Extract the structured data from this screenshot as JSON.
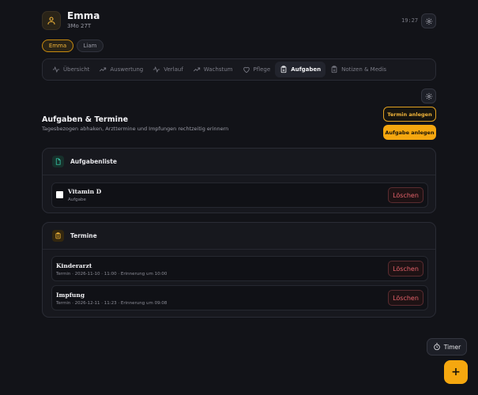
{
  "profile": {
    "name": "Emma",
    "age": "3Mo 27T",
    "clock": "19:27",
    "icon": "user-icon"
  },
  "children": [
    {
      "label": "Emma",
      "selected": true
    },
    {
      "label": "Liam",
      "selected": false
    }
  ],
  "tabs": [
    {
      "label": "Übersicht",
      "icon": "pulse-icon"
    },
    {
      "label": "Auswertung",
      "icon": "trend-icon"
    },
    {
      "label": "Verlauf",
      "icon": "pulse-icon"
    },
    {
      "label": "Wachstum",
      "icon": "trend-icon"
    },
    {
      "label": "Pflege",
      "icon": "heart-icon"
    },
    {
      "label": "Aufgaben",
      "icon": "clipboard-icon",
      "active": true
    },
    {
      "label": "Notizen & Medis",
      "icon": "clipboard-icon"
    }
  ],
  "page": {
    "title": "Aufgaben & Termine",
    "subtitle": "Tagesbezogen abhaken, Arzttermine und Impfungen rechtzeitig erinnern",
    "add_appointment": "Termin anlegen",
    "add_task": "Aufgabe anlegen"
  },
  "tasks": {
    "title": "Aufgabenliste",
    "items": [
      {
        "title": "Vitamin D",
        "sub": "Aufgabe",
        "delete": "Löschen"
      }
    ]
  },
  "appointments": {
    "title": "Termine",
    "items": [
      {
        "title": "Kinderarzt",
        "sub": "Termin · 2026-11-10 · 11:00 · Erinnerung um 10:00",
        "delete": "Löschen"
      },
      {
        "title": "Impfung",
        "sub": "Termin · 2026-12-11 · 11:23 · Erinnerung um 09:08",
        "delete": "Löschen"
      }
    ]
  },
  "timer": {
    "label": "Timer"
  },
  "fab": {
    "label": "+"
  },
  "colors": {
    "accent": "#f5a70f",
    "danger": "#e4626a",
    "background": "#121318",
    "card": "#17181e"
  }
}
